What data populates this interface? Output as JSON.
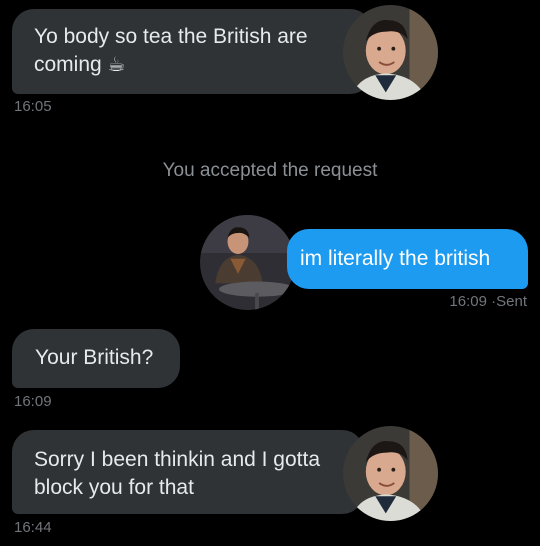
{
  "messages": [
    {
      "text": "Yo body so tea the British are coming",
      "emoji": "☕",
      "time": "16:05",
      "side": "incoming"
    },
    {
      "text": "You accepted the request"
    },
    {
      "text": "im literally the british",
      "time": "16:09",
      "status": "Sent",
      "side": "outgoing"
    },
    {
      "text": "Your British?",
      "time": "16:09",
      "side": "incoming"
    },
    {
      "text": "Sorry I been thinkin and I gotta block you for that",
      "time": "16:44",
      "side": "incoming"
    }
  ],
  "avatars": {
    "incoming": "profile-photo-man-smiling",
    "outgoing": "profile-photo-man-seated"
  },
  "colors": {
    "background": "#000000",
    "incoming_bubble": "#2f3336",
    "outgoing_bubble": "#1d9bf0",
    "timestamp": "#71767b"
  }
}
